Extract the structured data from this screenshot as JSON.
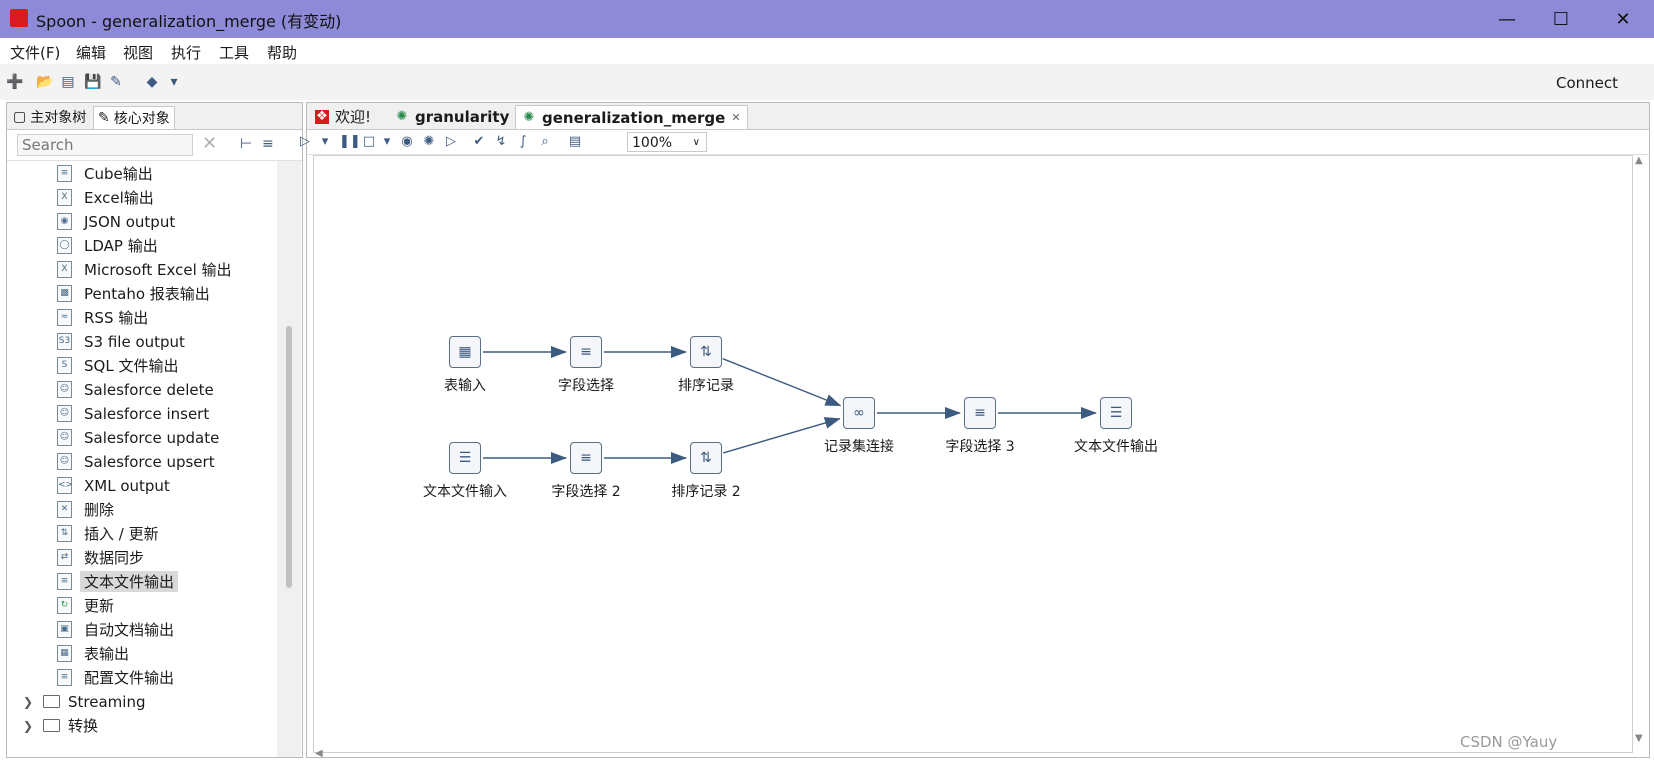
{
  "window": {
    "title": "Spoon - generalization_merge (有变动)"
  },
  "menu": [
    "文件(F)",
    "编辑",
    "视图",
    "执行",
    "工具",
    "帮助"
  ],
  "toolbar": {
    "connect": "Connect"
  },
  "left_tabs": [
    {
      "label": "主对象树",
      "icon": "tree-icon"
    },
    {
      "label": "核心对象",
      "icon": "pencil-icon"
    }
  ],
  "search": {
    "placeholder": "Search"
  },
  "tree_items": [
    "Cube输出",
    "Excel输出",
    "JSON output",
    "LDAP 输出",
    "Microsoft Excel 输出",
    "Pentaho 报表输出",
    "RSS 输出",
    "S3 file output",
    "SQL 文件输出",
    "Salesforce delete",
    "Salesforce insert",
    "Salesforce update",
    "Salesforce upsert",
    "XML output",
    "删除",
    "插入 / 更新",
    "数据同步",
    "文本文件输出",
    "更新",
    "自动文档输出",
    "表输出",
    "配置文件输出"
  ],
  "tree_selected": "文本文件输出",
  "tree_folders": [
    "Streaming",
    "转换"
  ],
  "editor_tabs": [
    {
      "label": "欢迎!",
      "icon": "spoon-icon"
    },
    {
      "label": "granularity",
      "icon": "transformation-icon"
    },
    {
      "label": "generalization_merge",
      "icon": "transformation-icon"
    }
  ],
  "zoom": "100%",
  "steps": [
    {
      "id": "s1",
      "label": "表输入",
      "icon": "table-input-icon"
    },
    {
      "id": "s2",
      "label": "字段选择",
      "icon": "select-values-icon"
    },
    {
      "id": "s3",
      "label": "排序记录",
      "icon": "sort-icon"
    },
    {
      "id": "s4",
      "label": "文本文件输入",
      "icon": "text-input-icon"
    },
    {
      "id": "s5",
      "label": "字段选择 2",
      "icon": "select-values-icon"
    },
    {
      "id": "s6",
      "label": "排序记录 2",
      "icon": "sort-icon"
    },
    {
      "id": "s7",
      "label": "记录集连接",
      "icon": "merge-join-icon"
    },
    {
      "id": "s8",
      "label": "字段选择 3",
      "icon": "select-values-icon"
    },
    {
      "id": "s9",
      "label": "文本文件输出",
      "icon": "text-output-icon"
    }
  ],
  "hops": [
    [
      "s1",
      "s2"
    ],
    [
      "s2",
      "s3"
    ],
    [
      "s3",
      "s7"
    ],
    [
      "s4",
      "s5"
    ],
    [
      "s5",
      "s6"
    ],
    [
      "s6",
      "s7"
    ],
    [
      "s7",
      "s8"
    ],
    [
      "s8",
      "s9"
    ]
  ],
  "watermark": "CSDN @Yauy"
}
